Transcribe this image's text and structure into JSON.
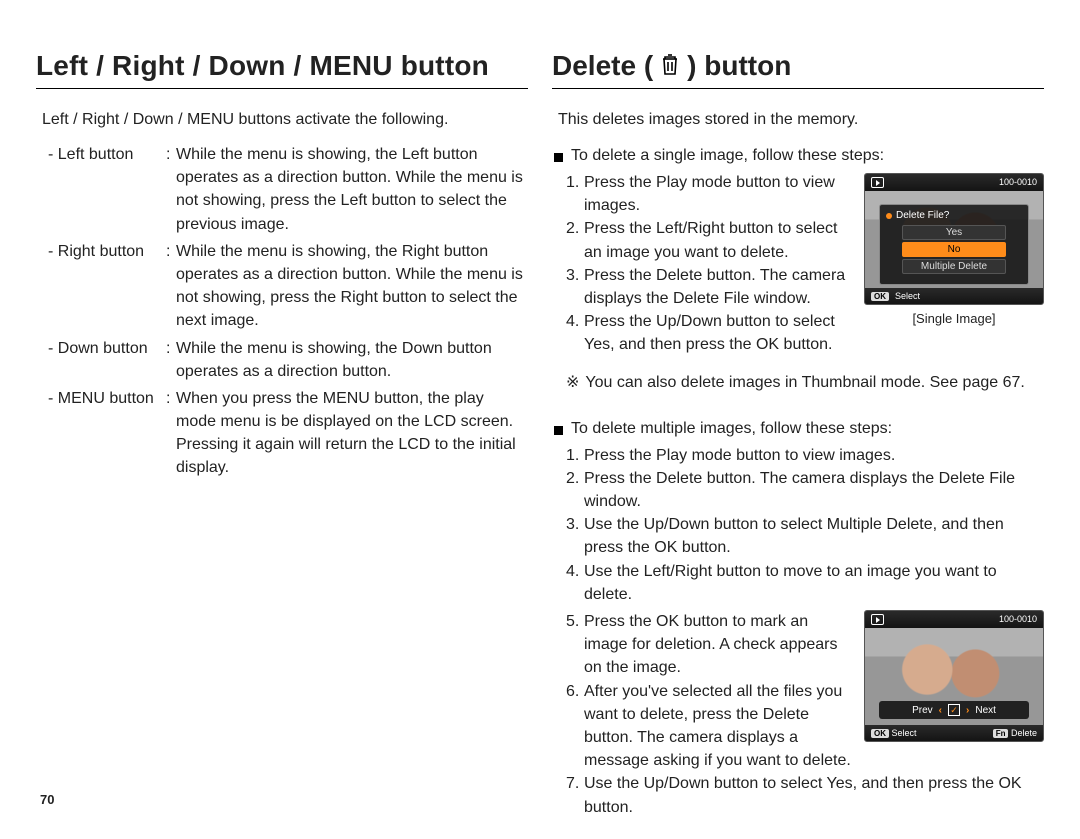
{
  "page_number": "70",
  "left": {
    "title": "Left / Right / Down / MENU button",
    "lead": "Left / Right / Down / MENU buttons activate the following.",
    "items": [
      {
        "label": "- Left button",
        "body": "While the menu is showing, the Left button operates as a direction button. While the menu is not showing, press the Left button to select the previous image."
      },
      {
        "label": "- Right button",
        "body": "While the menu is showing, the Right button operates as a direction button. While the menu is not showing, press the Right button to select the next image."
      },
      {
        "label": "- Down button",
        "body": "While the menu is showing, the Down button operates as a direction button."
      },
      {
        "label": "- MENU button",
        "body": "When you press the MENU button, the play mode menu is be displayed on the LCD screen. Pressing it again will return the LCD to the initial display."
      }
    ]
  },
  "right": {
    "title_a": "Delete (",
    "title_b": ") button",
    "lead": "This deletes images stored in the memory.",
    "single_bullet": "To delete a single image, follow these steps:",
    "single_steps": [
      "Press the Play mode button to view images.",
      "Press the Left/Right button to select an image you want to delete.",
      "Press the Delete button. The camera displays the Delete File window.",
      "Press the Up/Down button to select Yes, and then press the OK button."
    ],
    "note": "You can also delete images in Thumbnail mode. See page 67.",
    "caption1": "[Single Image]",
    "screen1": {
      "counter": "100-0010",
      "dlg_title": "Delete File?",
      "opt_yes": "Yes",
      "opt_no": "No",
      "opt_multi": "Multiple Delete",
      "ok": "OK",
      "select": "Select"
    },
    "multi_bullet": "To delete multiple images, follow these steps:",
    "multi_steps": [
      "Press the Play mode button to view images.",
      "Press the Delete button. The camera displays the Delete File window.",
      "Use the Up/Down button to select Multiple Delete, and then press the OK button.",
      "Use the Left/Right button to move to an image you want to delete.",
      "Press the OK button to mark an image for deletion. A check appears on the image.",
      "After you've selected all the files you want to delete, press the Delete button. The camera displays a message asking if you want to delete.",
      "Use the Up/Down button to select Yes, and then press the OK button."
    ],
    "screen2": {
      "counter": "100-0010",
      "prev": "Prev",
      "next": "Next",
      "select": "Select",
      "delete": "Delete"
    }
  }
}
